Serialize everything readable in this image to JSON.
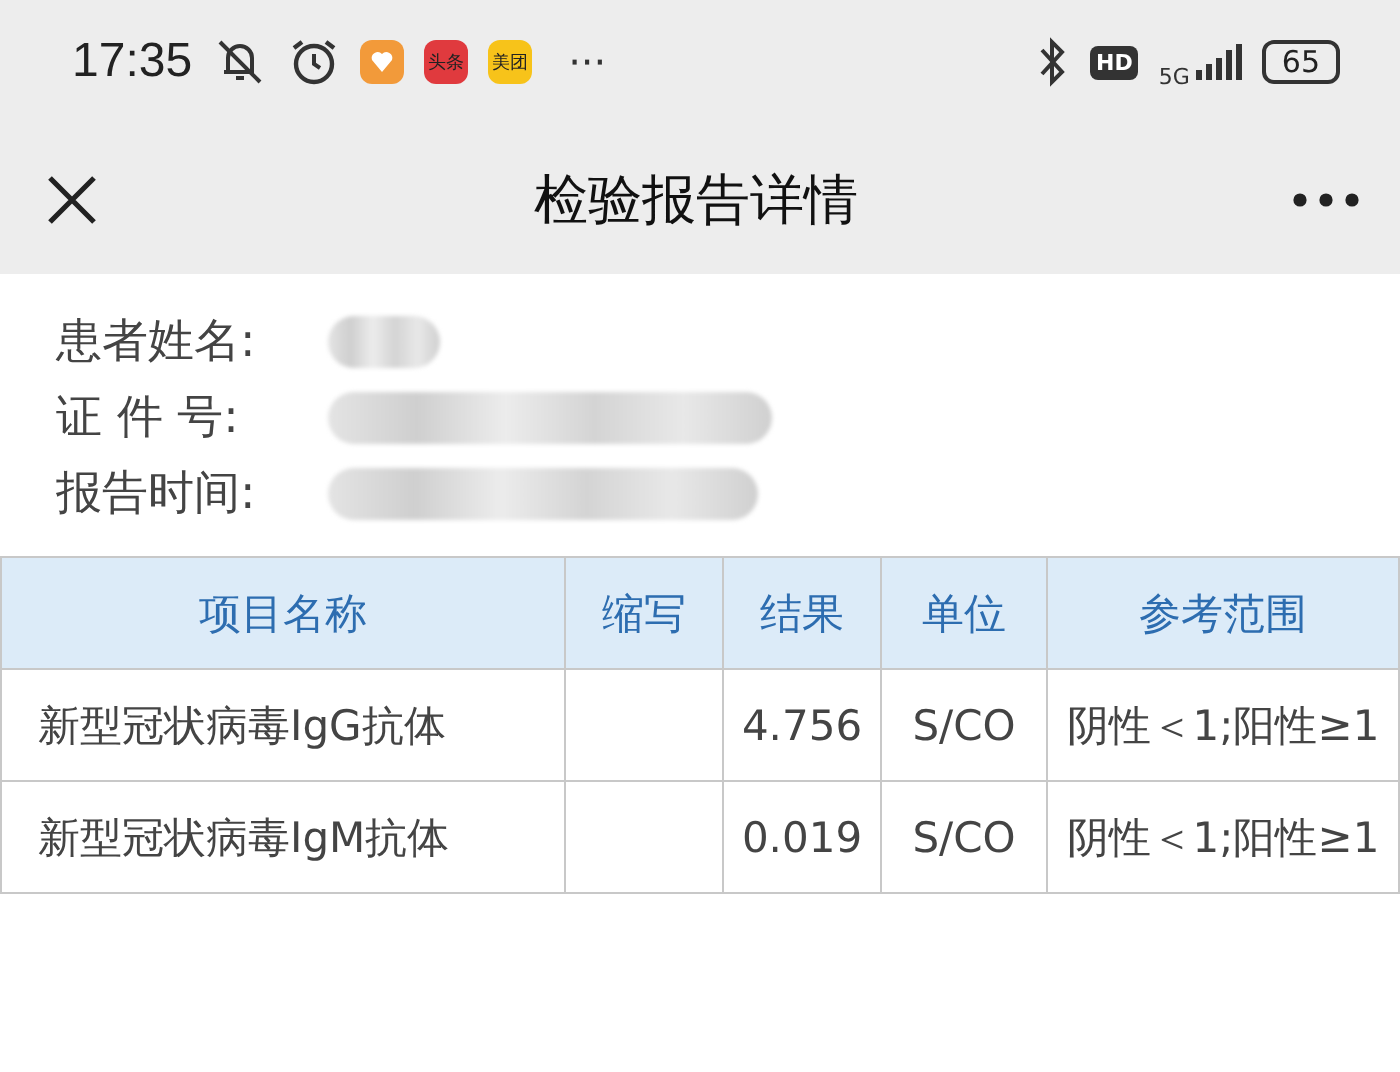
{
  "status_bar": {
    "time": "17:35",
    "apps": [
      {
        "kind": "heart",
        "color": "#f29a3a"
      },
      {
        "kind": "label",
        "label": "头条",
        "color": "#e03a3e"
      },
      {
        "kind": "label",
        "label": "美团",
        "color": "#f7c31a"
      }
    ],
    "more": "···",
    "network": "5G",
    "hd": "HD",
    "battery": "65"
  },
  "header": {
    "title": "检验报告详情"
  },
  "patient": [
    {
      "label": "患者姓名:"
    },
    {
      "label": "证 件 号:"
    },
    {
      "label": "报告时间:"
    }
  ],
  "table": {
    "columns": [
      "项目名称",
      "缩写",
      "结果",
      "单位",
      "参考范围"
    ],
    "rows": [
      [
        "新型冠状病毒IgG抗体",
        "",
        "4.756",
        "S/CO",
        "阴性＜1;阳性≥1"
      ],
      [
        "新型冠状病毒IgM抗体",
        "",
        "0.019",
        "S/CO",
        "阴性＜1;阳性≥1"
      ]
    ]
  }
}
